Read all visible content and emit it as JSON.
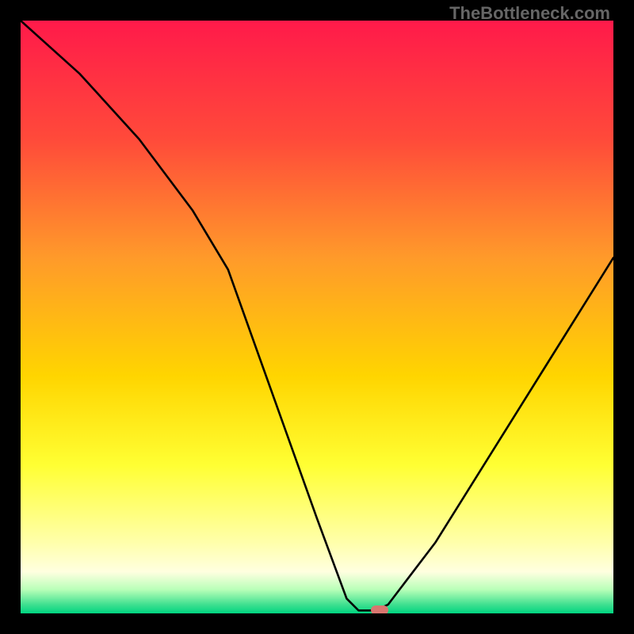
{
  "watermark": "TheBottleneck.com",
  "chart_data": {
    "type": "line",
    "title": "",
    "xlabel": "",
    "ylabel": "",
    "xlim": [
      0,
      100
    ],
    "ylim": [
      0,
      100
    ],
    "gradient_stops": [
      {
        "offset": 0,
        "color": "#ff1a4a"
      },
      {
        "offset": 20,
        "color": "#ff4a3a"
      },
      {
        "offset": 40,
        "color": "#ff9a2a"
      },
      {
        "offset": 60,
        "color": "#ffd500"
      },
      {
        "offset": 75,
        "color": "#ffff33"
      },
      {
        "offset": 88,
        "color": "#ffffaa"
      },
      {
        "offset": 93,
        "color": "#ffffe0"
      },
      {
        "offset": 96,
        "color": "#b8ffb8"
      },
      {
        "offset": 98.5,
        "color": "#40e090"
      },
      {
        "offset": 100,
        "color": "#00d480"
      }
    ],
    "series": [
      {
        "name": "bottleneck-curve",
        "x": [
          0,
          10,
          20,
          29,
          35,
          40,
          45,
          50,
          55,
          57,
          60,
          62,
          70,
          80,
          90,
          100
        ],
        "y": [
          100,
          91,
          80,
          68,
          58,
          44,
          30,
          16,
          2.5,
          0.5,
          0.5,
          1.5,
          12,
          28,
          44,
          60
        ]
      }
    ],
    "marker": {
      "x": 60.5,
      "y": 0.6
    }
  }
}
